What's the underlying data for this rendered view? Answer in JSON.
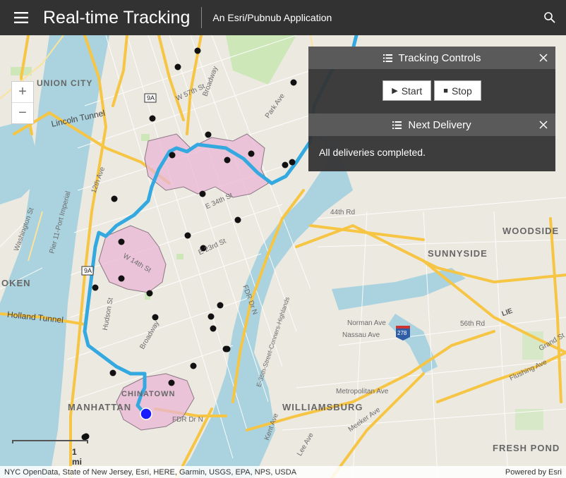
{
  "header": {
    "title": "Real-time Tracking",
    "subtitle": "An Esri/Pubnub Application"
  },
  "zoom": {
    "in_label": "+",
    "out_label": "−"
  },
  "scalebar": {
    "label": "1 mi"
  },
  "attribution": {
    "sources": "NYC OpenData, State of New Jersey, Esri, HERE, Garmin, USGS, EPA, NPS, USDA",
    "powered": "Powered by Esri"
  },
  "tracking_panel": {
    "title": "Tracking Controls",
    "start_label": "Start",
    "stop_label": "Stop"
  },
  "delivery_panel": {
    "title": "Next Delivery",
    "message": "All deliveries completed."
  },
  "map_labels": {
    "manhattan": "MANHATTAN",
    "chinatown": "CHINATOWN",
    "williamsburg": "WILLIAMSBURG",
    "woodside": "WOODSIDE",
    "sunnyside": "SUNNYSIDE",
    "fresh_pond": "FRESH POND",
    "union_city": "UNION CITY",
    "hoboken": "OKEN",
    "lincoln_tunnel": "Lincoln Tunnel",
    "holland_tunnel": "Holland Tunnel",
    "fdr": "FDR Dr N",
    "fdr2": "FDR Dr N",
    "e35": "E-35th-Street-Conners-Highlands",
    "w57": "W 57th St",
    "e34": "E 34th St",
    "e23": "E 23rd St",
    "w14": "W 14th St",
    "broadway": "Broadway",
    "twelfth": "12th Ave",
    "hudson": "Hudson St",
    "meeker": "Meeker Ave",
    "metropolitan": "Metropolitan Ave",
    "grand": "Grand St",
    "norman": "Norman Ave",
    "nassau": "Nassau Ave",
    "park_ave": "Park Ave",
    "ave56": "56th Rd",
    "flushing": "Flushing Ave",
    "e44": "44th Rd",
    "lie": "LIE",
    "kent": "Kent Ave",
    "lee": "Lee Ave",
    "route9a": "9A",
    "route278": "278",
    "wash": "Washington St",
    "pier": "Pier 11-Port Imperial"
  },
  "deliveries": {
    "stops_count": 30,
    "vehicle_status": "stopped"
  },
  "colors": {
    "route": "#33a9e0",
    "zone": "#e9b6d6",
    "vehicle": "#1a1aff",
    "header_bg": "#323232"
  }
}
